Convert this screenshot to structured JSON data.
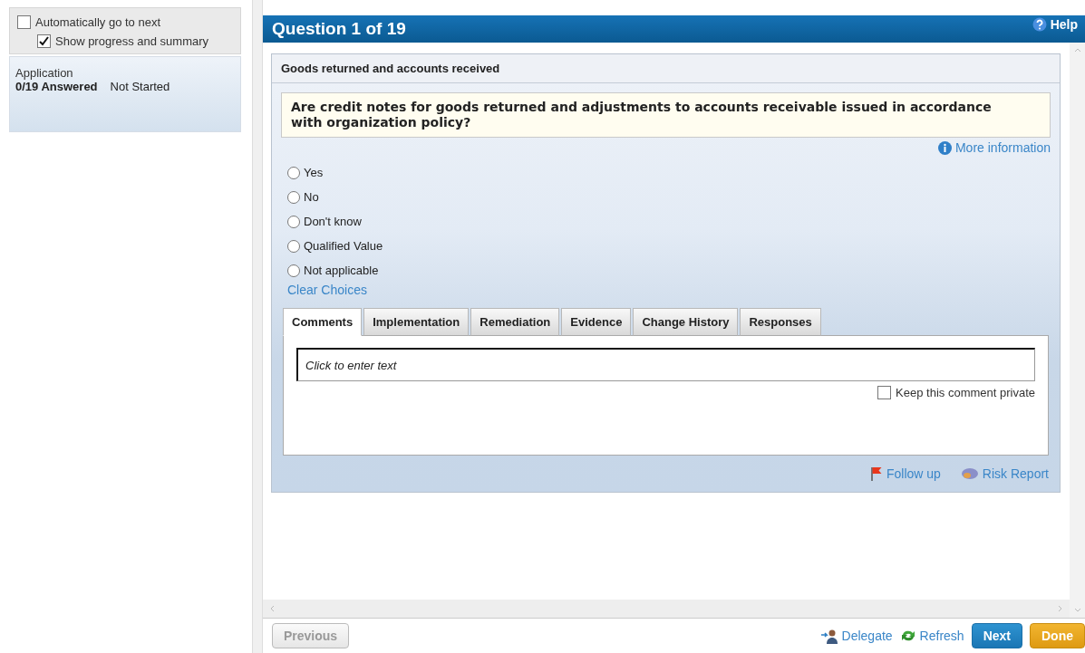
{
  "sidebar": {
    "options": [
      {
        "label": "Automatically go to next",
        "checked": false,
        "indent": false
      },
      {
        "label": "Show progress and summary",
        "checked": true,
        "indent": true
      }
    ],
    "summary": {
      "title": "Application",
      "answered": "0/19 Answered",
      "status": "Not Started"
    }
  },
  "header": {
    "title": "Question 1 of 19",
    "help": "Help"
  },
  "question": {
    "section": "Goods returned and accounts received",
    "text": "Are credit notes for goods returned and adjustments to accounts receivable issued in accordance with organization policy?",
    "more_info": "More information",
    "choices": [
      {
        "label": "Yes",
        "selected": false
      },
      {
        "label": "No",
        "selected": false
      },
      {
        "label": "Don't know",
        "selected": false
      },
      {
        "label": "Qualified Value",
        "selected": false
      },
      {
        "label": "Not applicable",
        "selected": false
      }
    ],
    "clear": "Clear Choices"
  },
  "tabs": [
    {
      "label": "Comments",
      "selected": true
    },
    {
      "label": "Implementation",
      "selected": false
    },
    {
      "label": "Remediation",
      "selected": false
    },
    {
      "label": "Evidence",
      "selected": false
    },
    {
      "label": "Change History",
      "selected": false
    },
    {
      "label": "Responses",
      "selected": false
    }
  ],
  "comment": {
    "placeholder": "Click to enter text",
    "private_label": "Keep this comment private",
    "private": false
  },
  "links": [
    {
      "kind": "flag",
      "label": "Follow up"
    },
    {
      "kind": "report",
      "label": "Risk Report"
    }
  ],
  "footer": {
    "previous": "Previous",
    "previous_disabled": true,
    "actions": [
      {
        "kind": "delegate",
        "label": "Delegate"
      },
      {
        "kind": "refresh",
        "label": "Refresh"
      }
    ],
    "next": "Next",
    "done": "Done"
  }
}
